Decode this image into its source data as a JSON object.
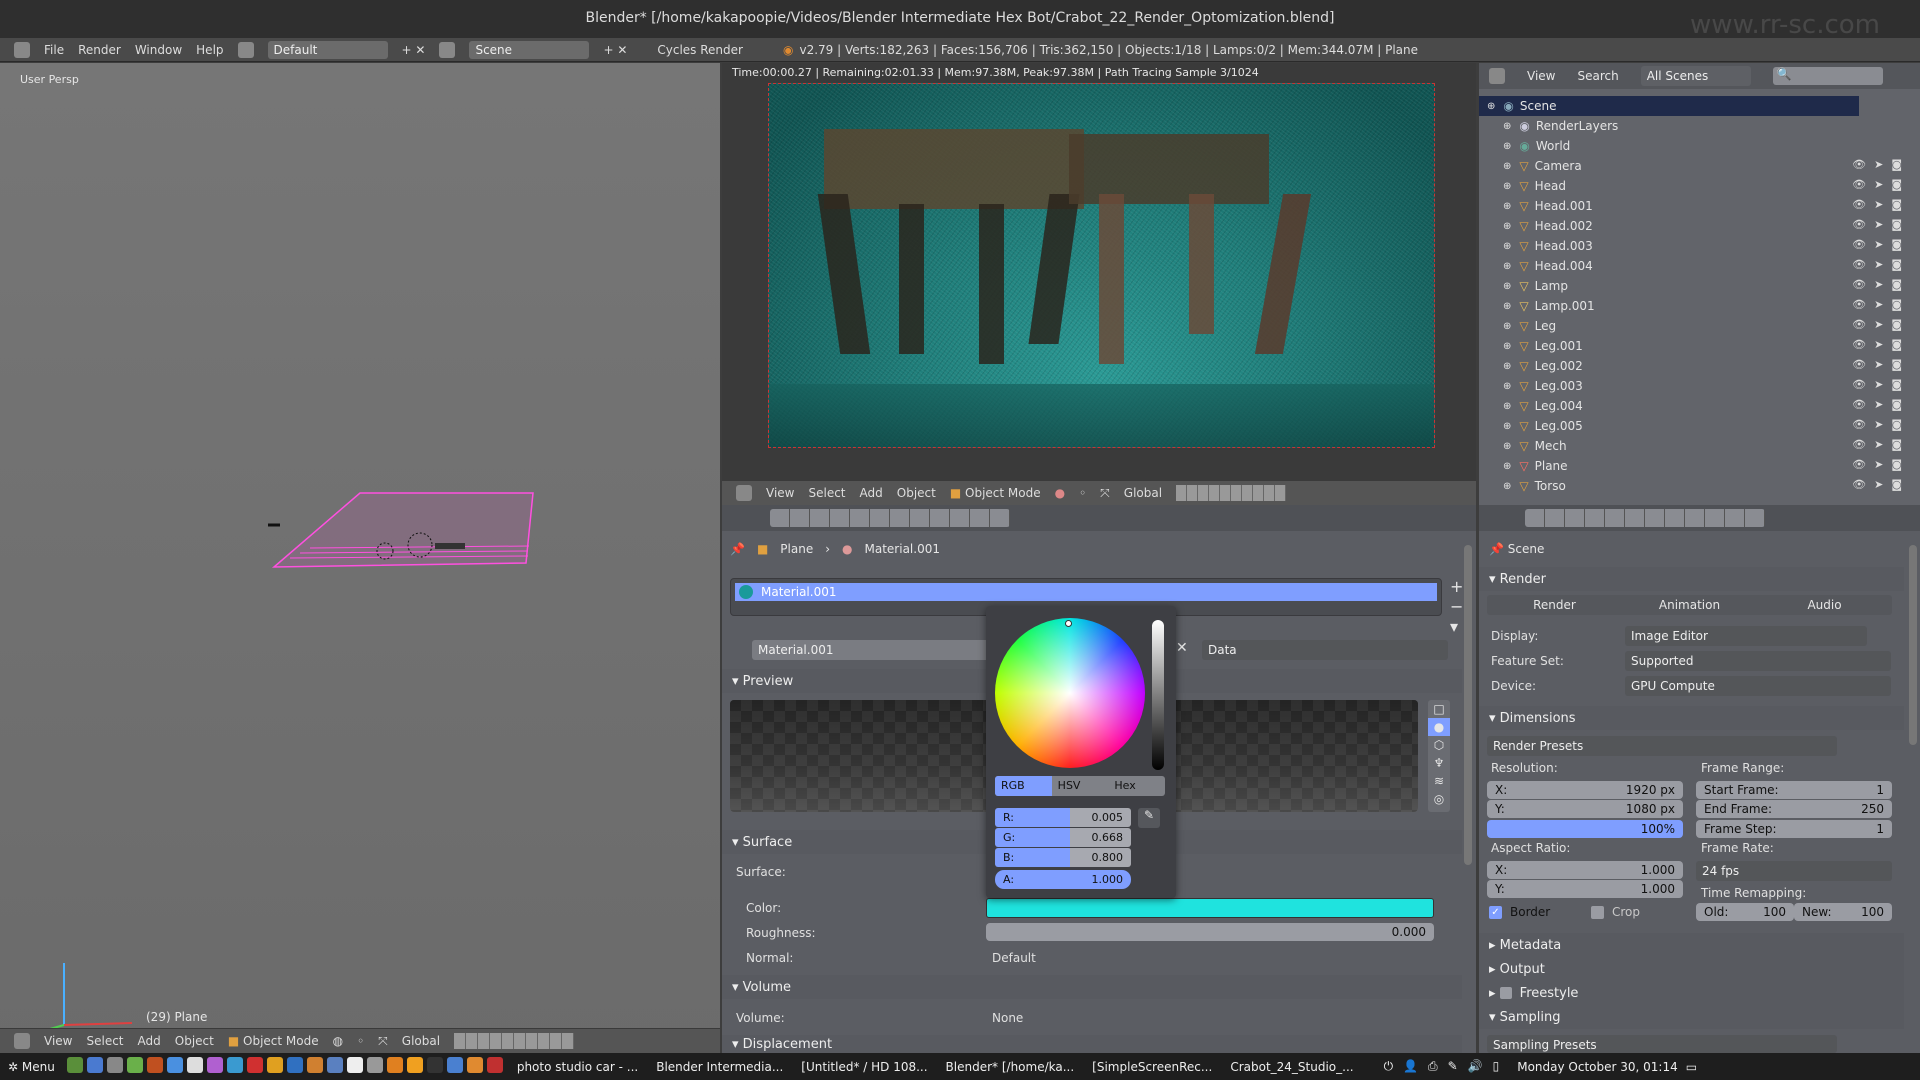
{
  "window": {
    "title": "Blender* [/home/kakapoopie/Videos/Blender Intermediate Hex Bot/Crabot_22_Render_Optomization.blend]",
    "watermark": "www.rr-sc.com"
  },
  "menubar": {
    "items": [
      "File",
      "Render",
      "Window",
      "Help"
    ],
    "layout": "Default",
    "scene": "Scene",
    "engine": "Cycles Render",
    "stats": "v2.79 | Verts:182,263 | Faces:156,706 | Tris:362,150 | Objects:1/18 | Lamps:0/2 | Mem:344.07M | Plane"
  },
  "viewport": {
    "label": "User Persp",
    "object_label": "(29) Plane",
    "header": {
      "menus": [
        "View",
        "Select",
        "Add",
        "Object"
      ],
      "mode": "Object Mode",
      "orientation": "Global"
    }
  },
  "render": {
    "status": "Time:00:00.27 | Remaining:02:01.33 | Mem:97.38M, Peak:97.38M | Path Tracing Sample 3/1024",
    "header": {
      "menus": [
        "View",
        "Select",
        "Add",
        "Object"
      ],
      "mode": "Object Mode",
      "orientation": "Global"
    }
  },
  "material": {
    "breadcrumb": [
      "Plane",
      "Material.001"
    ],
    "slot": "Material.001",
    "name": "Material.001",
    "link": "Data",
    "preview": "Preview",
    "surface_header": "Surface",
    "surface_label": "Surface:",
    "color_label": "Color:",
    "color_value": "#1fe3de",
    "roughness_label": "Roughness:",
    "roughness": "0.000",
    "normal_label": "Normal:",
    "normal": "Default",
    "volume_header": "Volume",
    "volume_label": "Volume:",
    "volume": "None",
    "displacement_header": "Displacement"
  },
  "picker": {
    "tabs": [
      "RGB",
      "HSV",
      "Hex"
    ],
    "active_tab": "RGB",
    "fields": [
      {
        "label": "R:",
        "value": "0.005"
      },
      {
        "label": "G:",
        "value": "0.668"
      },
      {
        "label": "B:",
        "value": "0.800"
      },
      {
        "label": "A:",
        "value": "1.000"
      }
    ]
  },
  "outliner": {
    "menus": [
      "View",
      "Search"
    ],
    "filter": "All Scenes",
    "items": [
      "Scene",
      "RenderLayers",
      "World",
      "Camera",
      "Head",
      "Head.001",
      "Head.002",
      "Head.003",
      "Head.004",
      "Lamp",
      "Lamp.001",
      "Leg",
      "Leg.001",
      "Leg.002",
      "Leg.003",
      "Leg.004",
      "Leg.005",
      "Mech",
      "Plane",
      "Torso"
    ]
  },
  "renderprops": {
    "context": "Scene",
    "render_header": "Render",
    "buttons": [
      "Render",
      "Animation",
      "Audio"
    ],
    "display_label": "Display:",
    "display": "Image Editor",
    "feature_label": "Feature Set:",
    "feature": "Supported",
    "device_label": "Device:",
    "device": "GPU Compute",
    "dimensions": "Dimensions",
    "presets": "Render Presets",
    "resolution": "Resolution:",
    "res_x_label": "X:",
    "res_x": "1920 px",
    "res_y_label": "Y:",
    "res_y": "1080 px",
    "res_pct": "100%",
    "frame_range": "Frame Range:",
    "start_label": "Start Frame:",
    "start": "1",
    "end_label": "End Frame:",
    "end": "250",
    "step_label": "Frame Step:",
    "step": "1",
    "aspect": "Aspect Ratio:",
    "asp_x_label": "X:",
    "asp_x": "1.000",
    "asp_y_label": "Y:",
    "asp_y": "1.000",
    "frame_rate": "Frame Rate:",
    "fps": "24 fps",
    "time_remap": "Time Remapping:",
    "old_label": "Old:",
    "old": "100",
    "new_label": "New:",
    "new": "100",
    "border": "Border",
    "border_checked": true,
    "crop": "Crop",
    "crop_checked": false,
    "metadata": "Metadata",
    "output": "Output",
    "freestyle": "Freestyle",
    "sampling": "Sampling",
    "sampling_presets": "Sampling Presets"
  },
  "taskbar": {
    "menu": "Menu",
    "windows": [
      "photo studio car - ...",
      "Blender Intermedia...",
      "[Untitled* / HD 108...",
      "Blender* [/home/ka...",
      "[SimpleScreenRec...",
      "Crabot_24_Studio_..."
    ],
    "clock": "Monday October 30, 01:14"
  }
}
